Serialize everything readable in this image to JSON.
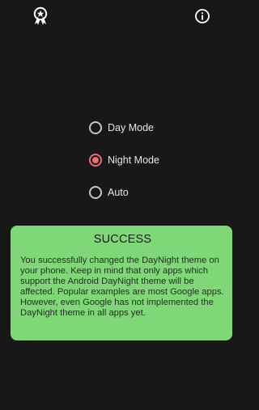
{
  "app_bar": {
    "left_icon": "award-badge-icon",
    "right_icon": "info-icon"
  },
  "modes": {
    "options": [
      {
        "label": "Day Mode",
        "selected": false
      },
      {
        "label": "Night Mode",
        "selected": true
      },
      {
        "label": "Auto",
        "selected": false
      }
    ]
  },
  "result": {
    "title": "SUCCESS",
    "message": "You successfully changed the DayNight theme on your phone. Keep in mind that only apps which support the Android DayNight theme will be affected. Popular examples are most Google apps. However, even Google has not implemented the DayNight theme in all apps yet."
  },
  "colors": {
    "background": "#181818",
    "accent": "#f06c73",
    "success_card": "#7fd778"
  }
}
